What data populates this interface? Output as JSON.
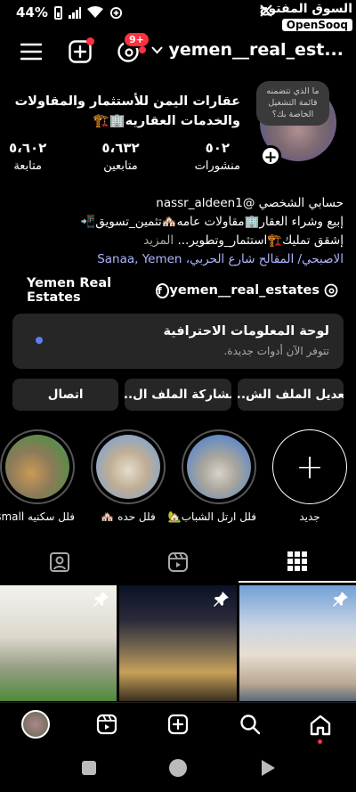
{
  "status": {
    "battery": "44%",
    "brand_arabic": "السوق المفتوح",
    "brand_latin": "OpenSooq"
  },
  "topbar": {
    "username": "yemen__real_est...",
    "notif_badge": "9+"
  },
  "profile": {
    "note": "ما الذي تتضمنه قائمة التشغيل الخاصة بك؟",
    "name_line1": "عقارات اليمن للأستثمار والمقاولات",
    "name_line2": "والخدمات العقاريه🏢🏗️",
    "stats": [
      {
        "value": "٥٠٢",
        "label": "منشورات"
      },
      {
        "value": "٥،٦٣٢",
        "label": "متابعين"
      },
      {
        "value": "٥،٦٠٢",
        "label": "متابعة"
      }
    ]
  },
  "bio": {
    "line1": "حسابي الشخصي @nassr_aldeen1",
    "line2": "إبيع وشراء العقار🏢مقاولات عامه🏘️تثمين_تسويق📲",
    "line3": "إشقق تمليك🏗️استثمار_وتطوير...",
    "more": "المزيد",
    "location": "الاصبحي/ المقالح شارع الحربي، Sanaa, Yemen"
  },
  "socials": {
    "facebook": "Yemen Real Estates",
    "threads": "yemen__real_estates"
  },
  "dashboard": {
    "title": "لوحة المعلومات الاحترافية",
    "subtitle": "تتوفر الآن أدوات جديدة."
  },
  "actions": {
    "edit": "تعديل الملف الش...",
    "share": "مشاركة الملف ال...",
    "contact": "اتصال"
  },
  "highlights": [
    {
      "label": "جديد"
    },
    {
      "label": "فلل ارتل الشباب🏡"
    },
    {
      "label": "فلل حده 🏘️"
    },
    {
      "label": "فلل سكنيه small"
    }
  ],
  "colors": {
    "accent_red": "#ff3040",
    "link_blue": "#aeb4ff",
    "card_bg": "#262626"
  }
}
